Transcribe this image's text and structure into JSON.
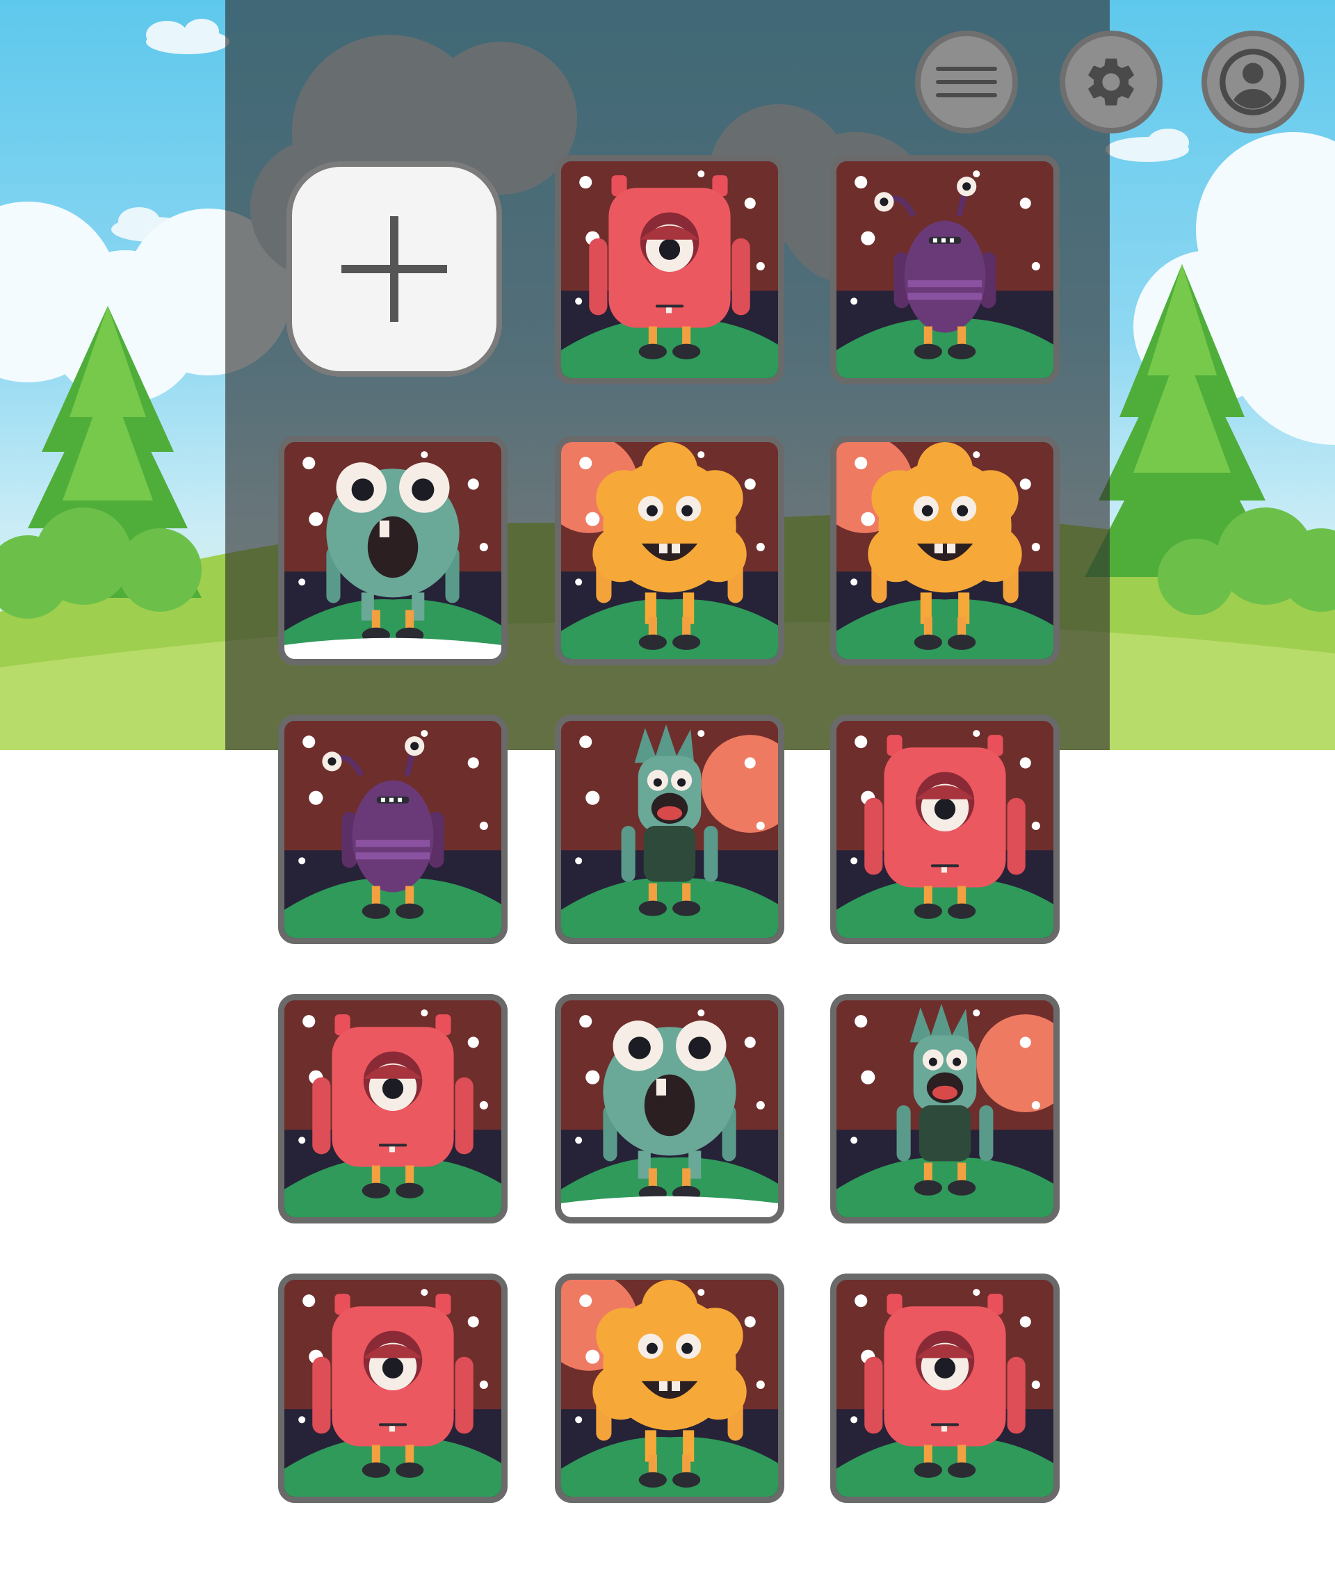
{
  "toolbar": {
    "menu_icon": "hamburger-menu-icon",
    "settings_icon": "gear-icon",
    "profile_icon": "user-profile-icon"
  },
  "add_tile": {
    "icon": "plus-icon"
  },
  "monsters": [
    {
      "type": "red-cyclops"
    },
    {
      "type": "purple-antenna"
    },
    {
      "type": "green-frog"
    },
    {
      "type": "orange-blob"
    },
    {
      "type": "orange-blob"
    },
    {
      "type": "purple-antenna"
    },
    {
      "type": "green-zombie"
    },
    {
      "type": "red-cyclops"
    },
    {
      "type": "red-cyclops"
    },
    {
      "type": "green-frog"
    },
    {
      "type": "green-zombie"
    },
    {
      "type": "red-cyclops"
    },
    {
      "type": "orange-blob"
    },
    {
      "type": "red-cyclops"
    }
  ],
  "colors": {
    "sky": "#5ec8ec",
    "tile_bg": "#6e2e2c",
    "tile_border": "#6a6a6a",
    "dark_band": "#262238",
    "grass": "#2f9a5a"
  }
}
